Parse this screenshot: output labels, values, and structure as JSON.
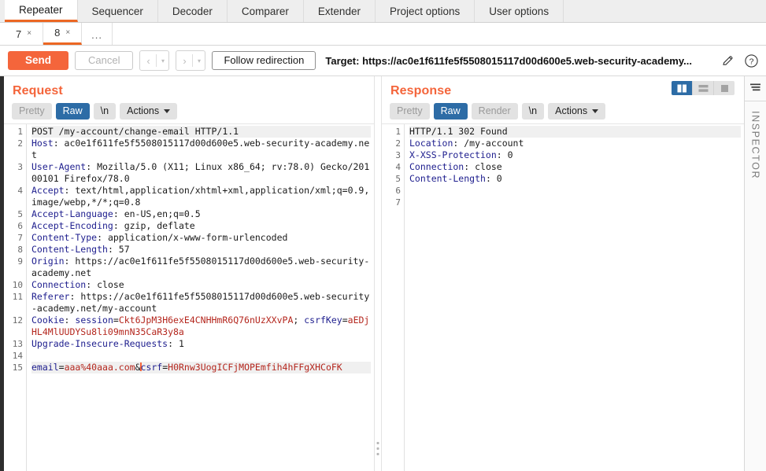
{
  "main_tabs": [
    {
      "label": "Repeater",
      "active": true
    },
    {
      "label": "Sequencer",
      "active": false
    },
    {
      "label": "Decoder",
      "active": false
    },
    {
      "label": "Comparer",
      "active": false
    },
    {
      "label": "Extender",
      "active": false
    },
    {
      "label": "Project options",
      "active": false
    },
    {
      "label": "User options",
      "active": false
    }
  ],
  "repeater_tabs": [
    {
      "label": "7",
      "close": "×",
      "active": false
    },
    {
      "label": "8",
      "close": "×",
      "active": true
    }
  ],
  "repeater_tabs_more": "...",
  "toolbar": {
    "send_label": "Send",
    "cancel_label": "Cancel",
    "prev_arrow": "‹",
    "next_arrow": "›",
    "caret": "▾",
    "follow_redirection_label": "Follow redirection",
    "target_label": "Target: https://ac0e1f611fe5f5508015117d00d600e5.web-security-academy...",
    "edit_icon": "pencil-icon",
    "help_icon": "question-icon"
  },
  "request": {
    "title": "Request",
    "tabs": [
      {
        "label": "Pretty",
        "active": false
      },
      {
        "label": "Raw",
        "active": true
      },
      {
        "label": "\\n",
        "active": false
      }
    ],
    "actions_label": "Actions",
    "lines": [
      {
        "n": "1",
        "highlight": true,
        "parts": [
          {
            "t": "POST /my-account/change-email HTTP/1.1",
            "c": "val"
          }
        ]
      },
      {
        "n": "2",
        "parts": [
          {
            "t": "Host",
            "c": "hdr"
          },
          {
            "t": ": ac0e1f611fe5f5508015117d00d600e5.web-security-academy.net",
            "c": "val"
          }
        ]
      },
      {
        "n": "3",
        "parts": [
          {
            "t": "User-Agent",
            "c": "hdr"
          },
          {
            "t": ": Mozilla/5.0 (X11; Linux x86_64; rv:78.0) Gecko/20100101 Firefox/78.0",
            "c": "val"
          }
        ]
      },
      {
        "n": "4",
        "parts": [
          {
            "t": "Accept",
            "c": "hdr"
          },
          {
            "t": ": text/html,application/xhtml+xml,application/xml;q=0.9,image/webp,*/*;q=0.8",
            "c": "val"
          }
        ]
      },
      {
        "n": "5",
        "parts": [
          {
            "t": "Accept-Language",
            "c": "hdr"
          },
          {
            "t": ": en-US,en;q=0.5",
            "c": "val"
          }
        ]
      },
      {
        "n": "6",
        "parts": [
          {
            "t": "Accept-Encoding",
            "c": "hdr"
          },
          {
            "t": ": gzip, deflate",
            "c": "val"
          }
        ]
      },
      {
        "n": "7",
        "parts": [
          {
            "t": "Content-Type",
            "c": "hdr"
          },
          {
            "t": ": application/x-www-form-urlencoded",
            "c": "val"
          }
        ]
      },
      {
        "n": "8",
        "parts": [
          {
            "t": "Content-Length",
            "c": "hdr"
          },
          {
            "t": ": 57",
            "c": "val"
          }
        ]
      },
      {
        "n": "9",
        "parts": [
          {
            "t": "Origin",
            "c": "hdr"
          },
          {
            "t": ": https://ac0e1f611fe5f5508015117d00d600e5.web-security-academy.net",
            "c": "val"
          }
        ]
      },
      {
        "n": "10",
        "parts": [
          {
            "t": "Connection",
            "c": "hdr"
          },
          {
            "t": ": close",
            "c": "val"
          }
        ]
      },
      {
        "n": "11",
        "parts": [
          {
            "t": "Referer",
            "c": "hdr"
          },
          {
            "t": ": https://ac0e1f611fe5f5508015117d00d600e5.web-security-academy.net/my-account",
            "c": "val"
          }
        ]
      },
      {
        "n": "12",
        "parts": [
          {
            "t": "Cookie",
            "c": "hdr"
          },
          {
            "t": ": ",
            "c": "val"
          },
          {
            "t": "session",
            "c": "hdr"
          },
          {
            "t": "=",
            "c": "val"
          },
          {
            "t": "Ckt6JpM3H6exE4CNHHmR6Q76nUzXXvPA",
            "c": "red"
          },
          {
            "t": "; ",
            "c": "val"
          },
          {
            "t": "csrfKey",
            "c": "hdr"
          },
          {
            "t": "=",
            "c": "val"
          },
          {
            "t": "aEDjHL4MlUUDYSu8li09mnN35CaR3y8a",
            "c": "red"
          }
        ]
      },
      {
        "n": "13",
        "parts": [
          {
            "t": "Upgrade-Insecure-Requests",
            "c": "hdr"
          },
          {
            "t": ": 1",
            "c": "val"
          }
        ]
      },
      {
        "n": "14",
        "parts": []
      },
      {
        "n": "15",
        "highlight": true,
        "parts": [
          {
            "t": "email",
            "c": "hdr"
          },
          {
            "t": "=",
            "c": "val"
          },
          {
            "t": "aaa%40aaa.com",
            "c": "red"
          },
          {
            "t": "&",
            "c": "val"
          },
          {
            "t": "",
            "c": "caret"
          },
          {
            "t": "csrf",
            "c": "hdr"
          },
          {
            "t": "=",
            "c": "val"
          },
          {
            "t": "H0Rnw3UogICFjMOPEmfih4hFFgXHCoFK",
            "c": "red"
          }
        ]
      }
    ]
  },
  "response": {
    "title": "Response",
    "tabs": [
      {
        "label": "Pretty",
        "active": false
      },
      {
        "label": "Raw",
        "active": true
      },
      {
        "label": "Render",
        "active": false
      },
      {
        "label": "\\n",
        "active": false
      }
    ],
    "actions_label": "Actions",
    "view_modes": [
      {
        "name": "split-vertical-view",
        "active": true
      },
      {
        "name": "split-horizontal-view",
        "active": false
      },
      {
        "name": "single-pane-view",
        "active": false
      }
    ],
    "lines": [
      {
        "n": "1",
        "highlight": true,
        "parts": [
          {
            "t": "HTTP/1.1 302 Found",
            "c": "val"
          }
        ]
      },
      {
        "n": "2",
        "parts": [
          {
            "t": "Location",
            "c": "hdr"
          },
          {
            "t": ": /my-account",
            "c": "val"
          }
        ]
      },
      {
        "n": "3",
        "parts": [
          {
            "t": "X-XSS-Protection",
            "c": "hdr"
          },
          {
            "t": ": 0",
            "c": "val"
          }
        ]
      },
      {
        "n": "4",
        "parts": [
          {
            "t": "Connection",
            "c": "hdr"
          },
          {
            "t": ": close",
            "c": "val"
          }
        ]
      },
      {
        "n": "5",
        "parts": [
          {
            "t": "Content-Length",
            "c": "hdr"
          },
          {
            "t": ": 0",
            "c": "val"
          }
        ]
      },
      {
        "n": "6",
        "parts": []
      },
      {
        "n": "7",
        "parts": []
      }
    ]
  },
  "inspector": {
    "label": "INSPECTOR",
    "icon": "layers-icon"
  },
  "colors": {
    "accent_orange": "#f4653b",
    "tab_blue": "#2d6ca6",
    "header_blue": "#20208f",
    "value_red": "#b4261d"
  }
}
